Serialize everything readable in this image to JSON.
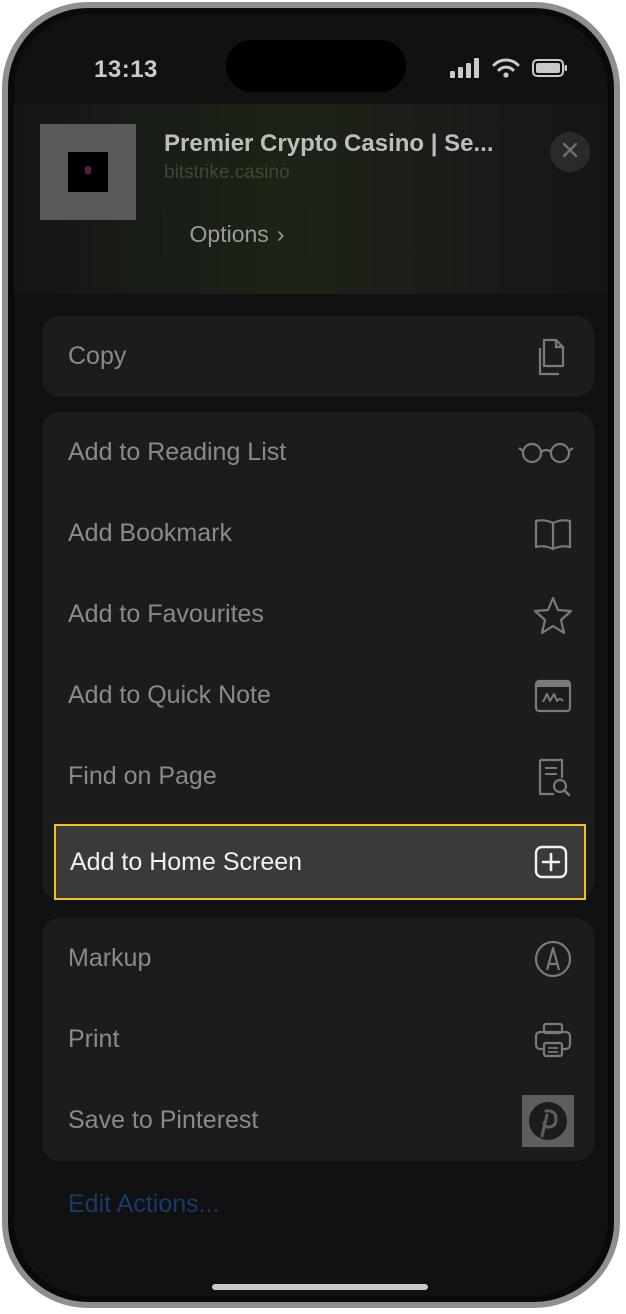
{
  "status_bar": {
    "time": "13:13"
  },
  "header": {
    "title": "Premier Crypto Casino | Se...",
    "url": "bitstrike.casino",
    "options_label": "Options",
    "options_chevron": "›"
  },
  "groups": {
    "copy": {
      "label": "Copy",
      "icon": "copy-icon"
    },
    "actions": [
      {
        "label": "Add to Reading List",
        "icon": "glasses-icon"
      },
      {
        "label": "Add Bookmark",
        "icon": "book-icon"
      },
      {
        "label": "Add to Favourites",
        "icon": "star-icon"
      },
      {
        "label": "Add to Quick Note",
        "icon": "quick-note-icon"
      },
      {
        "label": "Find on Page",
        "icon": "find-on-page-icon"
      }
    ],
    "highlighted": {
      "label": "Add to Home Screen",
      "icon": "plus-square-icon"
    },
    "more": [
      {
        "label": "Markup",
        "icon": "markup-icon"
      },
      {
        "label": "Print",
        "icon": "printer-icon"
      },
      {
        "label": "Save to Pinterest",
        "icon": "pinterest-icon"
      }
    ]
  },
  "edit_actions_label": "Edit Actions...",
  "colors": {
    "highlight_border": "#f2c21b",
    "link": "#153a6b",
    "row_text": "#8a8a8a"
  }
}
